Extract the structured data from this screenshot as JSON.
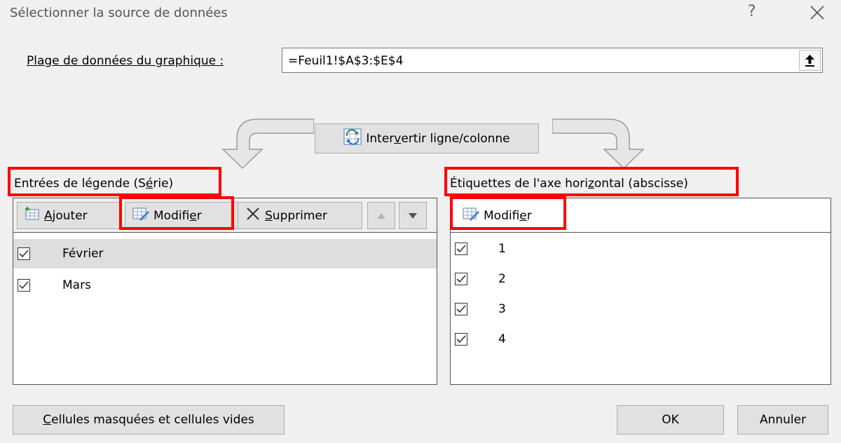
{
  "dialog": {
    "title": "Sélectionner la source de données",
    "help_label": "?",
    "close_icon": "close-icon"
  },
  "range": {
    "label": "Plage de données du graphique :",
    "value": "=Feuil1!$A$3:$E$4",
    "collapse_icon": "collapse-upload-icon"
  },
  "swap_button": {
    "label_pre": "Inter",
    "label_u": "v",
    "label_post": "ertir ligne/colonne",
    "icon": "swap-row-column-icon"
  },
  "legend": {
    "heading_pre": "Entrées de légende (S",
    "heading_u": "é",
    "heading_post": "rie)",
    "toolbar": {
      "add": {
        "label_u": "A",
        "label_post": "jouter",
        "icon": "add-table-icon"
      },
      "edit": {
        "label_pre": "Modifi",
        "label_u": "e",
        "label_post": "r",
        "icon": "edit-table-icon"
      },
      "delete": {
        "label_u": "S",
        "label_post": "upprimer",
        "icon": "delete-x-icon"
      },
      "move_up_icon": "triangle-up-icon",
      "move_down_icon": "triangle-down-icon"
    },
    "series": [
      {
        "name": "Février",
        "checked": true,
        "selected": true
      },
      {
        "name": "Mars",
        "checked": true,
        "selected": false
      }
    ]
  },
  "axis": {
    "heading_pre": "Étiquettes de l'axe hori",
    "heading_u": "z",
    "heading_post": "ontal (abscisse)",
    "toolbar": {
      "edit": {
        "label_pre": "Modifi",
        "label_u": "e",
        "label_post": "r",
        "icon": "edit-table-icon"
      }
    },
    "labels": [
      {
        "value": "1",
        "checked": true
      },
      {
        "value": "2",
        "checked": true
      },
      {
        "value": "3",
        "checked": true
      },
      {
        "value": "4",
        "checked": true
      }
    ]
  },
  "footer": {
    "hidden_cells_u": "C",
    "hidden_cells_post": "ellules masquées et cellules vides",
    "ok": "OK",
    "cancel": "Annuler"
  },
  "colors": {
    "highlight_box": "#ff0000",
    "dialog_bg": "#f0f0f0",
    "button_bg": "#e1e1e1"
  }
}
